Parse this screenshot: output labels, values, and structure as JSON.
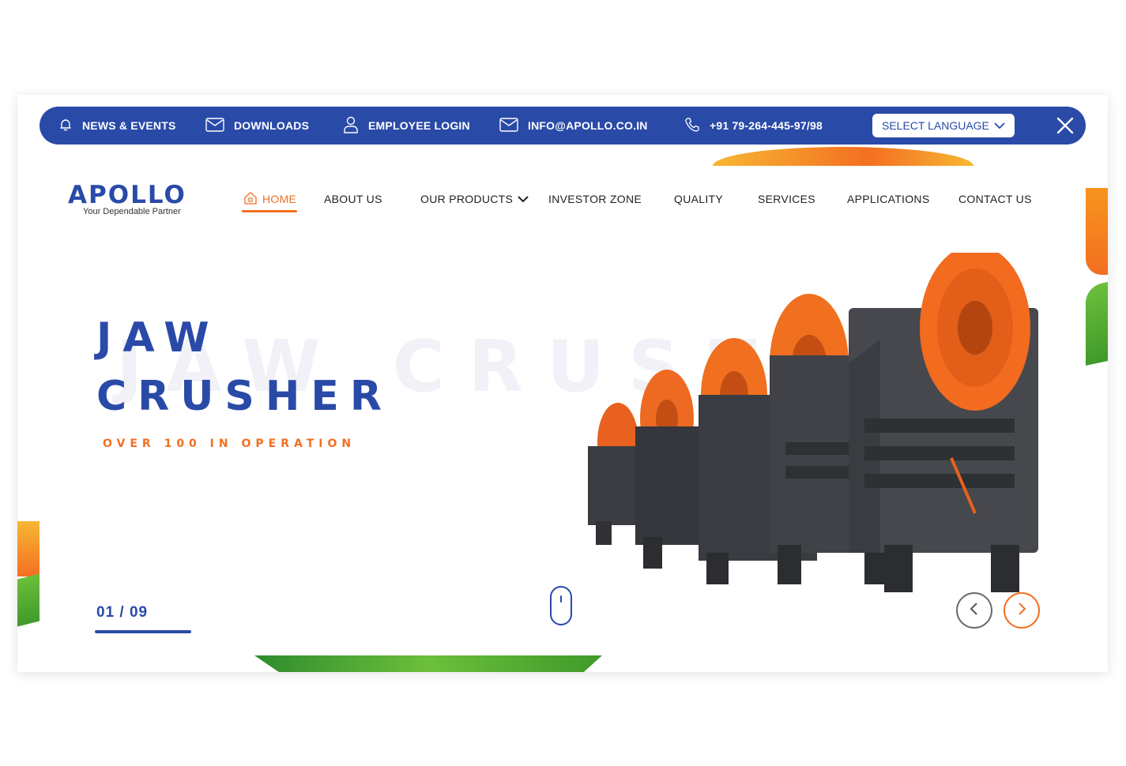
{
  "topbar": {
    "news_events": "NEWS & EVENTS",
    "downloads": "DOWNLOADS",
    "employee_login": "EMPLOYEE LOGIN",
    "email": "INFO@APOLLO.CO.IN",
    "phone": "+91 79-264-445-97/98",
    "language_select": "SELECT LANGUAGE"
  },
  "logo": {
    "brand": "APOLLO",
    "tagline": "Your Dependable Partner"
  },
  "nav": {
    "home": "HOME",
    "about": "ABOUT US",
    "products": "OUR PRODUCTS",
    "investor": "INVESTOR ZONE",
    "quality": "QUALITY",
    "services": "SERVICES",
    "applications": "APPLICATIONS",
    "contact": "CONTACT US"
  },
  "hero": {
    "title_line1": "JAW",
    "title_line2": "CRUSHER",
    "ghost_text": "JAW CRUSHER",
    "subtitle": "OVER 100 IN OPERATION",
    "slide_counter": "01 / 09",
    "slide_progress": 0.11
  },
  "colors": {
    "primary_blue": "#2a4aa8",
    "accent_orange": "#f36f21",
    "accent_green": "#3f9a2a"
  },
  "icons": {
    "news": "bell-icon",
    "downloads": "envelope-icon",
    "employee": "user-icon",
    "email": "envelope-icon",
    "phone": "phone-icon",
    "close": "close-icon",
    "prev": "chevron-left-icon",
    "next": "chevron-right-icon"
  }
}
